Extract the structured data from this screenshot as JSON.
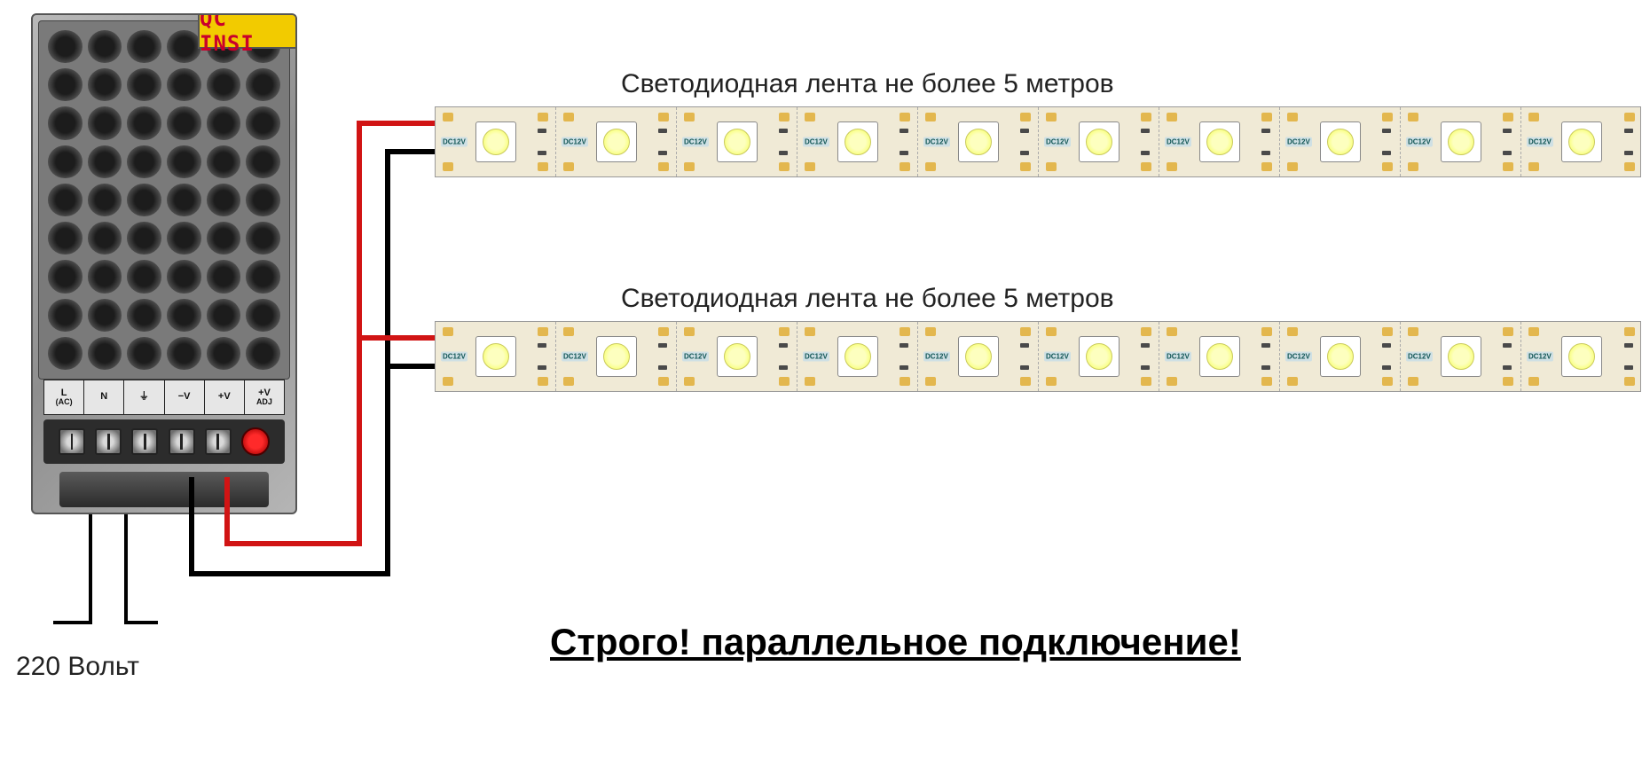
{
  "psu": {
    "qc_sticker": "QC INSI",
    "terminals": {
      "l": "L",
      "n": "N",
      "ac": "(AC)",
      "gnd": "⏚",
      "vminus": "−V",
      "vplus": "+V",
      "adj_top": "+V",
      "adj_bottom": "ADJ"
    }
  },
  "labels": {
    "strip1": "Светодиодная лента не более 5 метров",
    "strip2": "Светодиодная лента не более 5 метров",
    "warning": "Строго! параллельное подключение!",
    "input_voltage": "220 Вольт"
  },
  "strip": {
    "num_segments": 10,
    "marking": "DC12V",
    "voltage": "12V",
    "max_length_m": 5
  },
  "wiring": {
    "topology": "parallel",
    "positive_color": "#d11414",
    "negative_color": "#000000",
    "ac_input_volts": 220
  }
}
